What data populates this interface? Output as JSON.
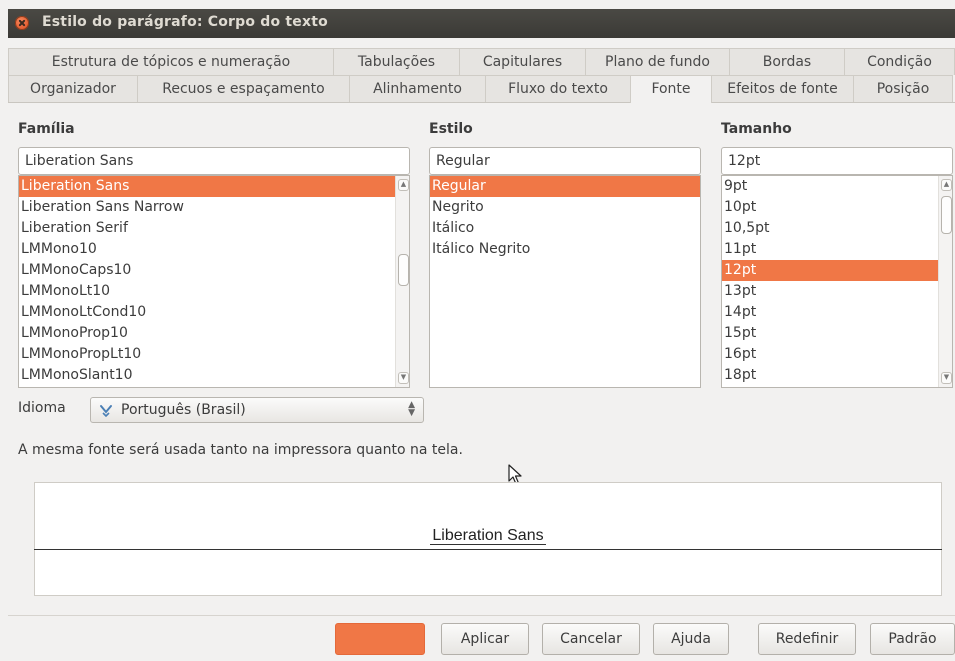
{
  "window": {
    "title": "Estilo do parágrafo: Corpo do texto"
  },
  "tabs_row1": [
    "Estrutura de tópicos e numeração",
    "Tabulações",
    "Capitulares",
    "Plano de fundo",
    "Bordas",
    "Condição"
  ],
  "tabs_row2": [
    "Organizador",
    "Recuos e espaçamento",
    "Alinhamento",
    "Fluxo do texto",
    "Fonte",
    "Efeitos de fonte",
    "Posição"
  ],
  "active_tab": "Fonte",
  "familia": {
    "label": "Família",
    "value": "Liberation Sans",
    "items": [
      "Liberation Sans",
      "Liberation Sans Narrow",
      "Liberation Serif",
      "LMMono10",
      "LMMonoCaps10",
      "LMMonoLt10",
      "LMMonoLtCond10",
      "LMMonoProp10",
      "LMMonoPropLt10",
      "LMMonoSlant10"
    ],
    "selected": "Liberation Sans"
  },
  "estilo": {
    "label": "Estilo",
    "value": "Regular",
    "items": [
      "Regular",
      "Negrito",
      "Itálico",
      "Itálico Negrito"
    ],
    "selected": "Regular"
  },
  "tamanho": {
    "label": "Tamanho",
    "value": "12pt",
    "items": [
      "9pt",
      "10pt",
      "10,5pt",
      "11pt",
      "12pt",
      "13pt",
      "14pt",
      "15pt",
      "16pt",
      "18pt"
    ],
    "selected": "12pt"
  },
  "idioma": {
    "label": "Idioma",
    "value": "Português (Brasil)"
  },
  "info_text": "A mesma fonte será usada tanto na impressora quanto na tela.",
  "preview_text": "Liberation Sans",
  "buttons": {
    "ok": "",
    "aplicar": "Aplicar",
    "cancelar": "Cancelar",
    "ajuda": "Ajuda",
    "redefinir": "Redefinir",
    "padrao": "Padrão"
  },
  "colors": {
    "accent": "#f07746",
    "titlebar": "#3f3e3a",
    "background": "#f2f1f0"
  }
}
